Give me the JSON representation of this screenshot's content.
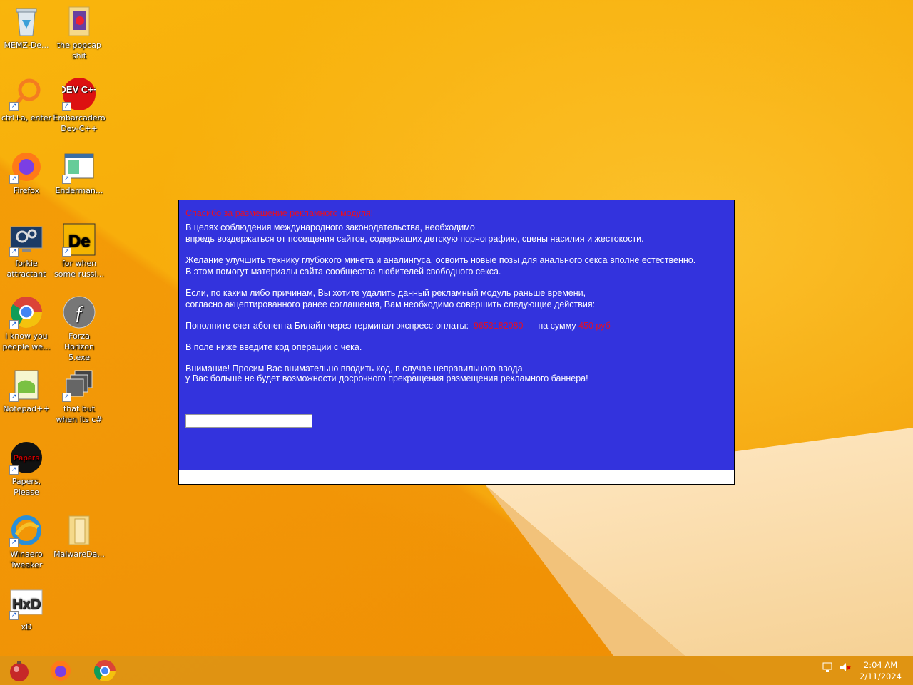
{
  "desktop_icons": [
    {
      "label": "MEMZ-De..."
    },
    {
      "label": "the popcap shit"
    },
    {
      "label": "ctrl+a, enter"
    },
    {
      "label": "Embarcadero Dev-C++"
    },
    {
      "label": "Firefox"
    },
    {
      "label": "Enderman..."
    },
    {
      "label": "forkie attractant"
    },
    {
      "label": "for when some russi..."
    },
    {
      "label": "i know you people we..."
    },
    {
      "label": "Forza Horizon 5.exe"
    },
    {
      "label": "Notepad++"
    },
    {
      "label": "that but when its c#"
    },
    {
      "label": "Papers, Please"
    },
    {
      "label": "Winaero Tweaker"
    },
    {
      "label": "MalwareDa..."
    },
    {
      "label": "xD"
    }
  ],
  "icon_texts": {
    "devcpp": "DEV C++",
    "de": "De",
    "hxd": "HxD",
    "papers": "Papers"
  },
  "modal": {
    "title": "Спасибо за размещение рекламного модуля!",
    "line1": "В целях соблюдения международного законодательства, необходимо",
    "line2": "впредь воздержаться от посещения сайтов, содержащих детскую порнографию, сцены насилия и жестокости.",
    "line3": "Желание улучшить технику глубокого минета и аналингуса, освоить новые позы для анального секса вполне естественно.",
    "line4": "В этом помогут материалы сайта сообщества любителей свободного секса.",
    "line5": "Если, по каким либо причинам, Вы хотите удалить данный рекламный модуль раньше времени,",
    "line6": "согласно акцептированного ранее соглашения, Вам необходимо совершить следующие действия:",
    "pay_prefix": "Пополните счет абонента Билайн через терминал экспресс-оплаты:",
    "phone": "9653182080",
    "pay_mid": "на сумму",
    "amount": "450 руб",
    "line8": "В поле ниже введите код операции с чека.",
    "line9": "Внимание! Просим Вас внимательно вводить код, в случае неправильного ввода",
    "line10": "у Вас больше не будет возможности досрочного прекращения размещения рекламного баннера!",
    "code_value": ""
  },
  "taskbar": {
    "apps": [
      "start-orb",
      "firefox",
      "chrome"
    ],
    "time": "2:04 AM",
    "date": "2/11/2024"
  },
  "colors": {
    "modal_bg": "#3333dd",
    "alert_red": "#e0102a"
  }
}
